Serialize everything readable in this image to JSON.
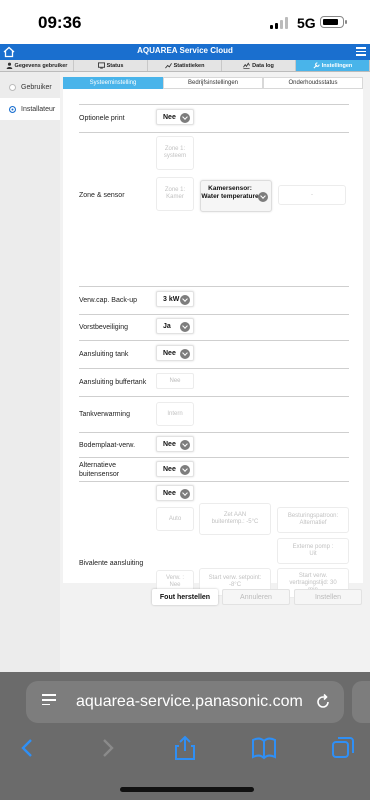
{
  "status_bar": {
    "time": "09:36",
    "network": "5G"
  },
  "app": {
    "title": "AQUAREA Service Cloud"
  },
  "tabs": [
    {
      "label": "Gegevens gebruiker",
      "icon": "user-icon"
    },
    {
      "label": "Status",
      "icon": "status-icon"
    },
    {
      "label": "Statistieken",
      "icon": "chart-icon"
    },
    {
      "label": "Data log",
      "icon": "datalog-icon"
    },
    {
      "label": "Instellingen",
      "icon": "wrench-icon",
      "active": true
    }
  ],
  "sidebar": {
    "items": [
      {
        "label": "Gebruiker"
      },
      {
        "label": "Installateur",
        "active": true
      }
    ]
  },
  "subtabs": [
    {
      "label": "Systeeminstelling",
      "active": true
    },
    {
      "label": "Bedrijfsinstellingen"
    },
    {
      "label": "Onderhoudsstatus"
    }
  ],
  "settings": {
    "optionele_print": {
      "label": "Optionele print",
      "value": "Nee"
    },
    "zone_sensor": {
      "label": "Zone & sensor",
      "zone1_system": "Zone 1: systeem",
      "zone1_kamer": "Zone 1: Kamer",
      "sensor": "Kamersensor: Water temperature",
      "dash": "-"
    },
    "backup": {
      "label": "Verw.cap. Back-up",
      "value": "3 kW"
    },
    "vorst": {
      "label": "Vorstbeveiliging",
      "value": "Ja"
    },
    "tank": {
      "label": "Aansluiting tank",
      "value": "Nee"
    },
    "buffertank": {
      "label": "Aansluiting buffertank",
      "value": "Nee"
    },
    "tankverwarming": {
      "label": "Tankverwarming",
      "value": "Intern"
    },
    "bodemplaat": {
      "label": "Bodemplaat-verw.",
      "value": "Nee"
    },
    "alt_sensor": {
      "label": "Alternatieve buitensensor",
      "value": "Nee"
    },
    "bivalent": {
      "label": "Bivalente aansluiting",
      "value": "Nee",
      "auto": "Auto",
      "aan_temp": "Zet AAN buitentemp.: -5°C",
      "patroon": "Besturingspatroon: Alternatief",
      "pump": "Externe pomp : Uit",
      "verw": "Verw. : Nee",
      "setpoint": "Start verw. setpoint: -8°C",
      "vertraging": "Start verw. vertragingstijd: 30 min"
    }
  },
  "buttons": {
    "reset": "Fout herstellen",
    "cancel": "Annuleren",
    "save": "Instellen"
  },
  "browser": {
    "url": "aquarea-service.panasonic.com"
  }
}
